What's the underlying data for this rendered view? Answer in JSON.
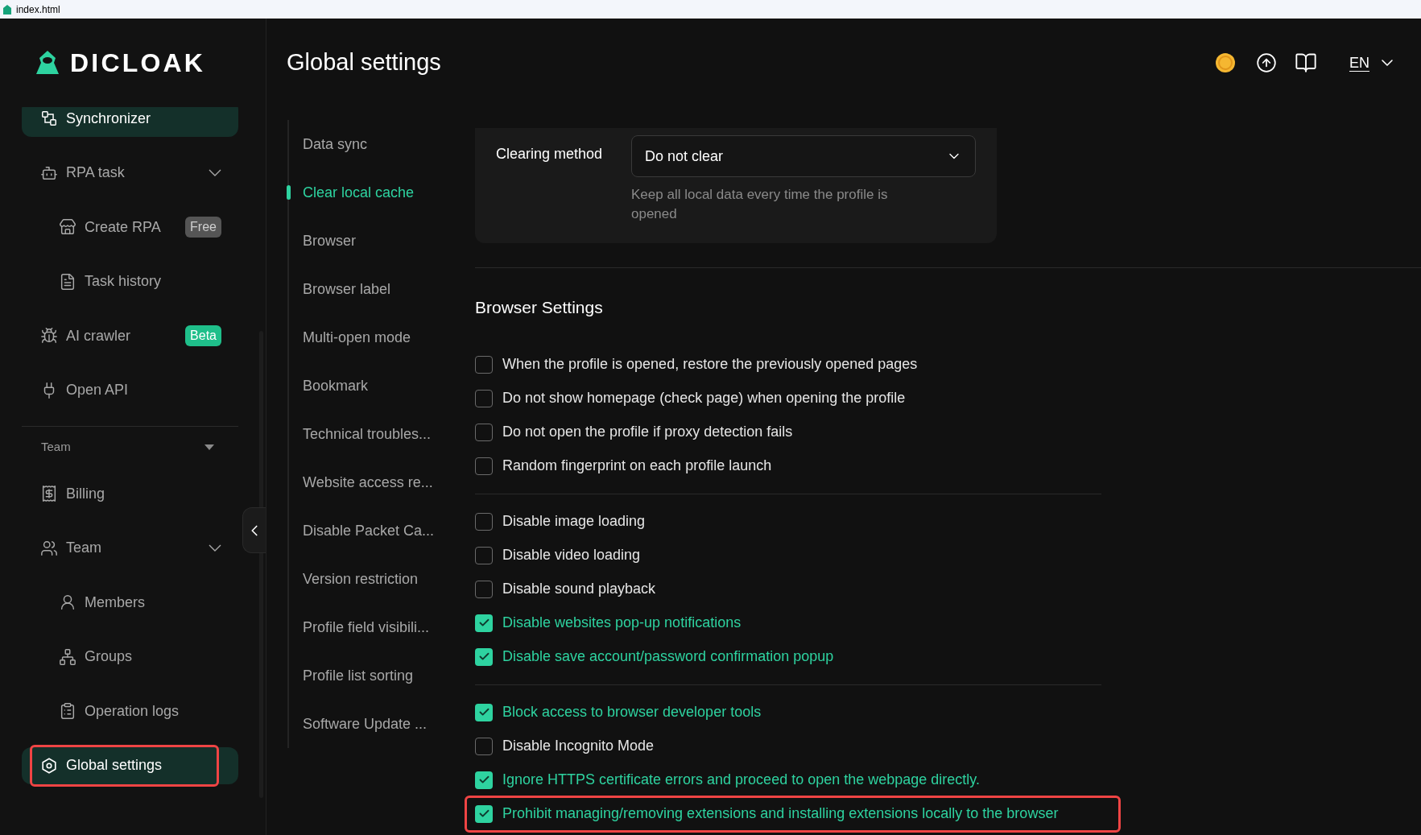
{
  "browser_tab": {
    "title": "index.html"
  },
  "sidebar": {
    "logo": "DICLOAK",
    "nav": [
      {
        "kind": "item",
        "label": "Synchronizer",
        "selected": true
      },
      {
        "kind": "item",
        "label": "RPA task",
        "selected": false,
        "expanded": true
      },
      {
        "kind": "sub",
        "label": "Create RPA",
        "selected": false,
        "badge": {
          "label": "Free",
          "kind": "muted"
        }
      },
      {
        "kind": "sub",
        "label": "Task history",
        "selected": false
      },
      {
        "kind": "item",
        "label": "AI crawler",
        "selected": false,
        "badge": {
          "label": "Beta",
          "kind": "accent"
        }
      },
      {
        "kind": "item",
        "label": "Open API",
        "selected": false
      },
      {
        "kind": "section",
        "label": "Team"
      },
      {
        "kind": "item",
        "label": "Billing",
        "selected": false
      },
      {
        "kind": "item",
        "label": "Team",
        "selected": false,
        "expanded": true
      },
      {
        "kind": "sub",
        "label": "Members",
        "selected": false
      },
      {
        "kind": "sub",
        "label": "Groups",
        "selected": false
      },
      {
        "kind": "sub",
        "label": "Operation logs",
        "selected": false
      },
      {
        "kind": "item",
        "label": "Global settings",
        "selected": true,
        "highlighted": true
      }
    ]
  },
  "header": {
    "title": "Global settings",
    "language": "EN"
  },
  "subnav": [
    {
      "label": "Data sync",
      "selected": false
    },
    {
      "label": "Clear local cache",
      "selected": true
    },
    {
      "label": "Browser",
      "selected": false
    },
    {
      "label": "Browser label",
      "selected": false
    },
    {
      "label": "Multi-open mode",
      "selected": false
    },
    {
      "label": "Bookmark",
      "selected": false
    },
    {
      "label": "Technical troubles...",
      "selected": false
    },
    {
      "label": "Website access re...",
      "selected": false
    },
    {
      "label": "Disable Packet Ca...",
      "selected": false
    },
    {
      "label": "Version restriction",
      "selected": false
    },
    {
      "label": "Profile field visibili...",
      "selected": false
    },
    {
      "label": "Profile list sorting",
      "selected": false
    },
    {
      "label": "Software Update ...",
      "selected": false
    }
  ],
  "clearing": {
    "label": "Clearing method",
    "value": "Do not clear",
    "hint": "Keep all local data every time the profile is opened"
  },
  "browser_settings": {
    "title": "Browser Settings",
    "groups": [
      [
        {
          "label": "When the profile is opened, restore the previously opened pages",
          "checked": false
        },
        {
          "label": "Do not show homepage (check page) when opening the profile",
          "checked": false
        },
        {
          "label": "Do not open the profile if proxy detection fails",
          "checked": false
        },
        {
          "label": "Random fingerprint on each profile launch",
          "checked": false
        }
      ],
      [
        {
          "label": "Disable image loading",
          "checked": false
        },
        {
          "label": "Disable video loading",
          "checked": false
        },
        {
          "label": "Disable sound playback",
          "checked": false
        },
        {
          "label": "Disable websites pop-up notifications",
          "checked": true
        },
        {
          "label": "Disable save account/password confirmation popup",
          "checked": true
        }
      ],
      [
        {
          "label": "Block access to browser developer tools",
          "checked": true
        },
        {
          "label": "Disable Incognito Mode",
          "checked": false
        },
        {
          "label": "Ignore HTTPS certificate errors and proceed to open the webpage directly.",
          "checked": true
        },
        {
          "label": "Prohibit managing/removing extensions and installing extensions locally to the browser",
          "checked": true,
          "highlighted": true
        }
      ]
    ]
  }
}
